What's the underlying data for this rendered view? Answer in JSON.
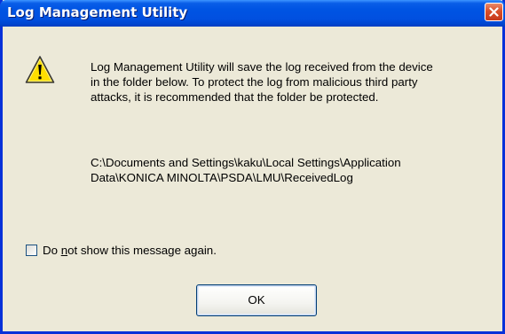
{
  "window": {
    "title": "Log Management Utility",
    "icon": "warning-icon"
  },
  "message": {
    "line1": "Log Management Utility will save the log received from the device",
    "line2": "in the folder below. To protect the log from malicious third party",
    "line3": "attacks, it is recommended that the folder be protected."
  },
  "path": {
    "line1": "C:\\Documents and Settings\\kaku\\Local Settings\\Application",
    "line2": "Data\\KONICA MINOLTA\\PSDA\\LMU\\ReceivedLog"
  },
  "checkbox": {
    "label_before": "Do ",
    "label_underlined": "n",
    "label_after": "ot show this message again.",
    "checked": false
  },
  "buttons": {
    "ok_label": "OK"
  },
  "colors": {
    "title_bar": "#0054e3",
    "close_button": "#d94f2a",
    "dialog_background": "#ece9d8",
    "warning_yellow": "#ffde00"
  }
}
